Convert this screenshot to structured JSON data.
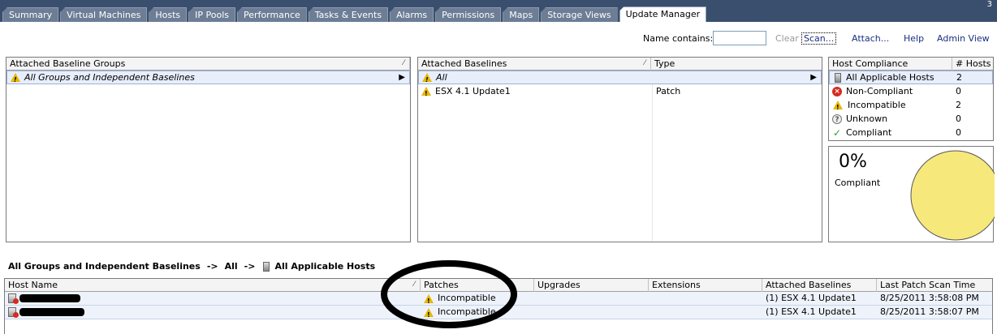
{
  "tabs": [
    "Summary",
    "Virtual Machines",
    "Hosts",
    "IP Pools",
    "Performance",
    "Tasks & Events",
    "Alarms",
    "Permissions",
    "Maps",
    "Storage Views",
    "Update Manager"
  ],
  "active_tab": "Update Manager",
  "window_number": "3",
  "toolbar": {
    "name_contains_label": "Name contains:",
    "name_value": "",
    "clear": "Clear",
    "scan": "Scan...",
    "attach": "Attach...",
    "help": "Help",
    "admin_view": "Admin View"
  },
  "baseline_groups": {
    "header": "Attached Baseline Groups",
    "rows": [
      "All Groups and Independent Baselines"
    ]
  },
  "baselines": {
    "headers": [
      "Attached Baselines",
      "Type"
    ],
    "all_row": "All",
    "rows": [
      {
        "name": "ESX 4.1 Update1",
        "type": "Patch"
      }
    ]
  },
  "compliance": {
    "headers": [
      "Host Compliance",
      "# Hosts"
    ],
    "rows": [
      {
        "label": "All Applicable Hosts",
        "count": "2",
        "icon": "host-icon"
      },
      {
        "label": "Non-Compliant",
        "count": "0",
        "icon": "error-icon"
      },
      {
        "label": "Incompatible",
        "count": "2",
        "icon": "warning-icon"
      },
      {
        "label": "Unknown",
        "count": "0",
        "icon": "question-icon"
      },
      {
        "label": "Compliant",
        "count": "0",
        "icon": "check-icon"
      }
    ],
    "percent": "0%",
    "percent_label": "Compliant",
    "pie_color": "#f7e87b"
  },
  "breadcrumb": {
    "part1": "All Groups and Independent Baselines",
    "sep": "->",
    "part2": "All",
    "part3": "All Applicable Hosts"
  },
  "hosts_table": {
    "headers": [
      "Host Name",
      "Patches",
      "Upgrades",
      "Extensions",
      "Attached Baselines",
      "Last Patch Scan Time"
    ],
    "rows": [
      {
        "patches": "Incompatible",
        "baselines": "(1) ESX 4.1 Update1",
        "scan_time": "8/25/2011 3:58:08 PM"
      },
      {
        "patches": "Incompatible",
        "baselines": "(1) ESX 4.1 Update1",
        "scan_time": "8/25/2011 3:58:07 PM"
      }
    ]
  }
}
